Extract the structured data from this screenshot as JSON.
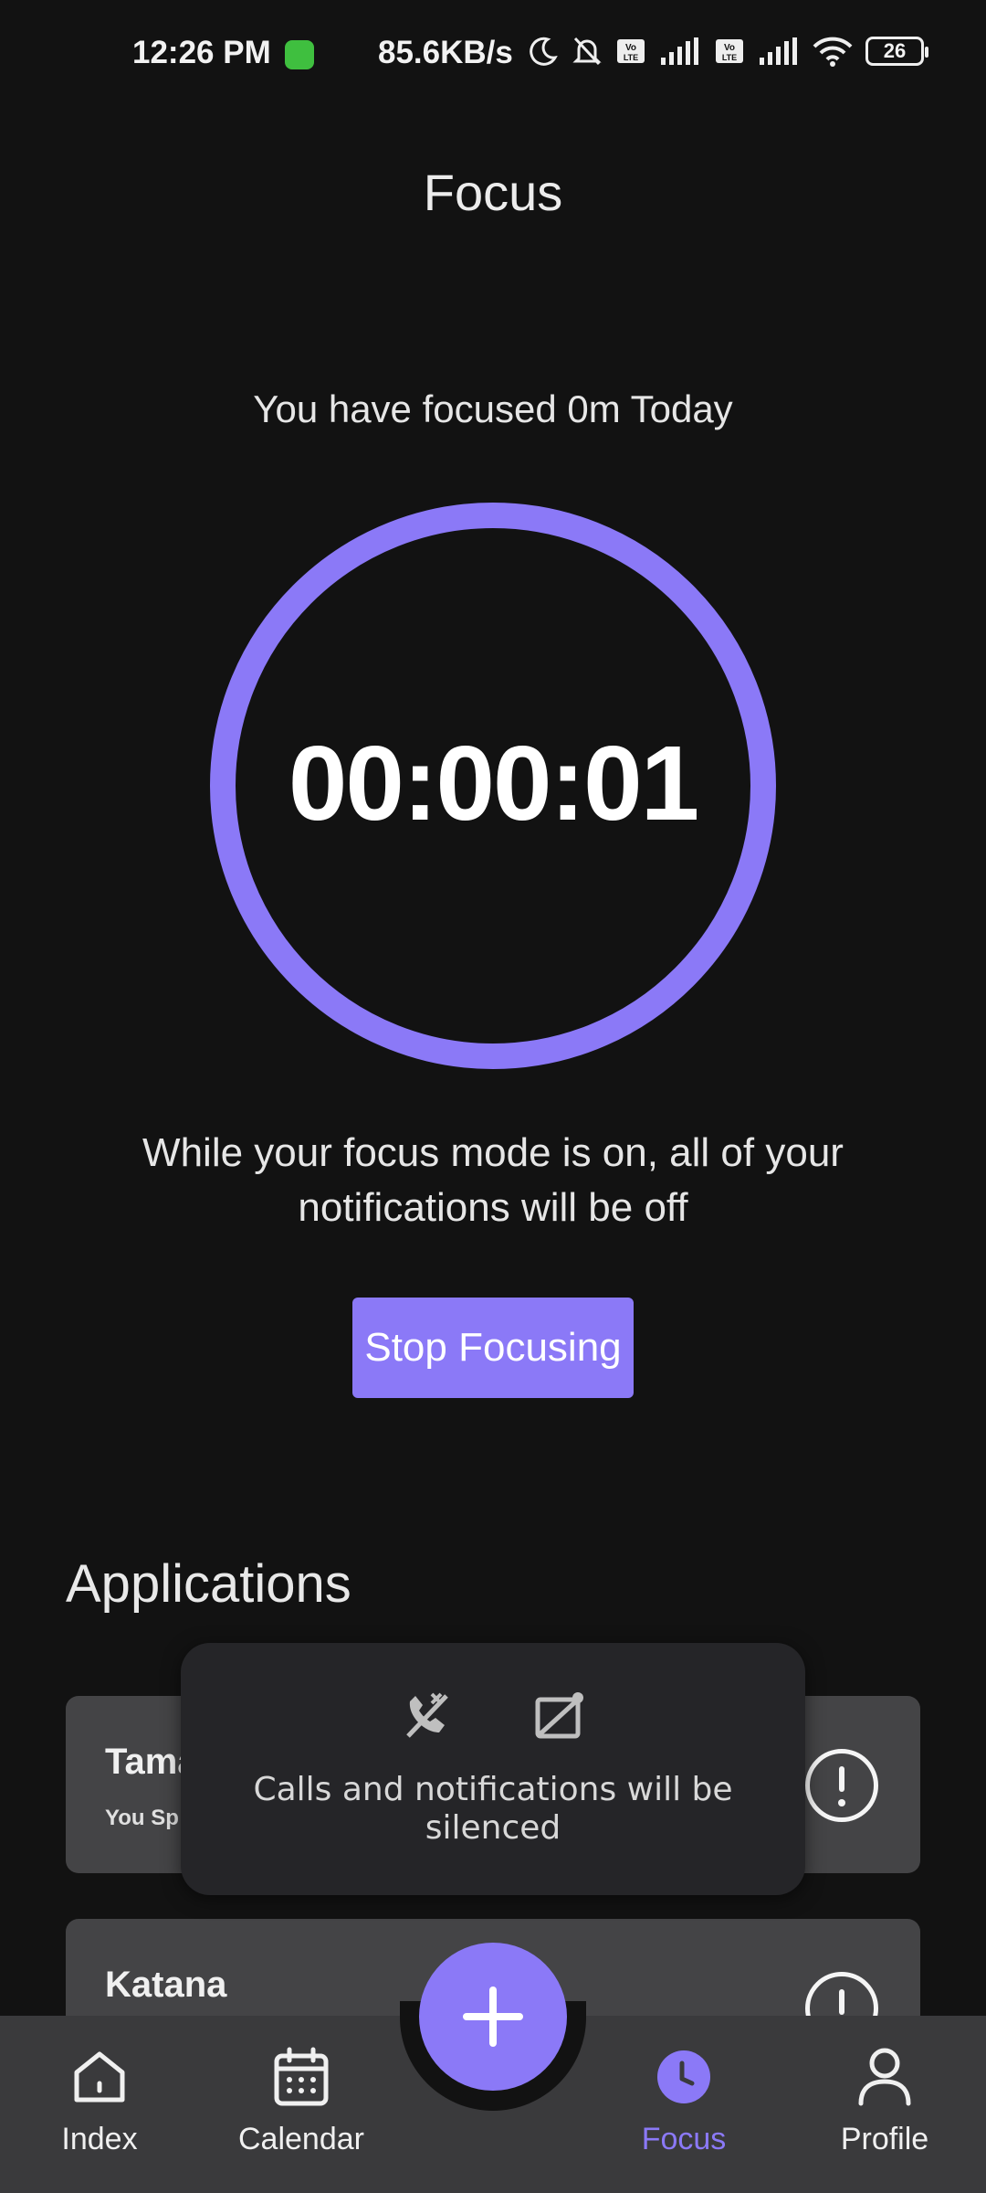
{
  "status_bar": {
    "time": "12:26 PM",
    "net_speed": "85.6KB/s",
    "battery": "26",
    "icons": [
      "app-notification-icon",
      "moon-icon",
      "bell-off-icon",
      "volte-icon",
      "signal-icon",
      "volte-icon",
      "signal-icon",
      "wifi-icon",
      "battery-icon"
    ]
  },
  "header": {
    "title": "Focus"
  },
  "focus": {
    "today_text": "You have focused 0m Today",
    "timer": "00:00:01",
    "info": "While your focus mode is on, all of your notifications will be off",
    "stop_label": "Stop Focusing"
  },
  "applications": {
    "title": "Applications",
    "items": [
      {
        "name": "Tama",
        "subtitle": "You Sp"
      },
      {
        "name": "Katana",
        "subtitle": ""
      }
    ]
  },
  "toast": {
    "message": "Calls and notifications will be silenced",
    "icons": [
      "phone-off-icon",
      "notification-off-icon"
    ]
  },
  "nav": {
    "items": [
      {
        "label": "Index",
        "icon": "home-icon"
      },
      {
        "label": "Calendar",
        "icon": "calendar-icon"
      },
      {
        "label": "Focus",
        "icon": "clock-icon",
        "active": true
      },
      {
        "label": "Profile",
        "icon": "person-icon"
      }
    ],
    "fab_icon": "plus-icon"
  },
  "colors": {
    "accent": "#8b79f7",
    "background": "#121212",
    "card": "#444446",
    "nav": "#3a3a3c"
  }
}
